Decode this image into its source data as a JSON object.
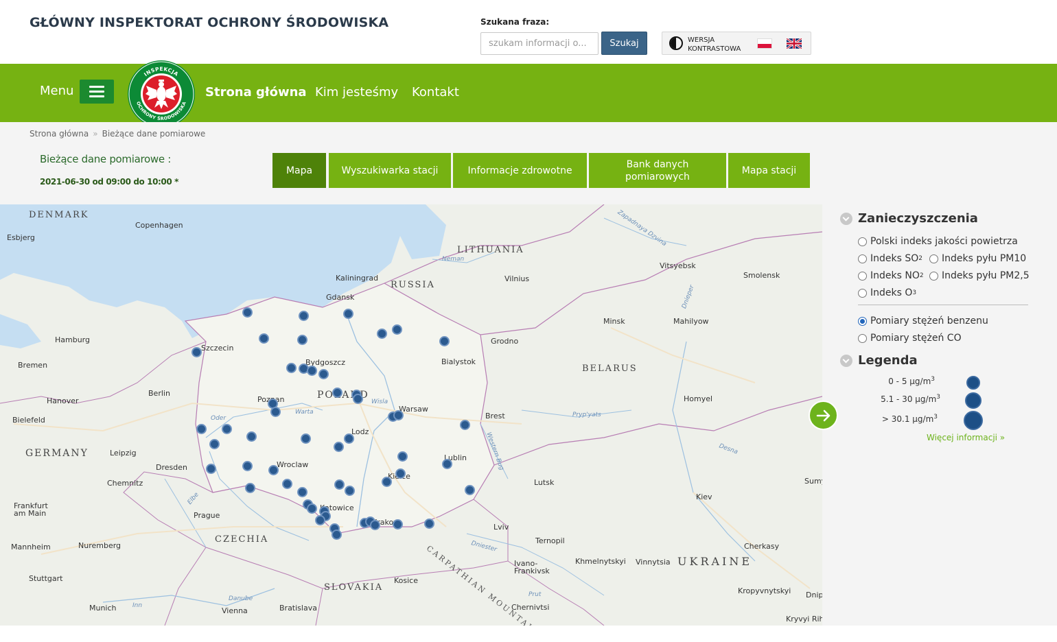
{
  "header": {
    "site_title": "GŁÓWNY INSPEKTORAT OCHRONY ŚRODOWISKA",
    "search_label": "Szukana fraza:",
    "search_placeholder": "szukam informacji o...",
    "search_button": "Szukaj",
    "contrast_line1": "WERSJA",
    "contrast_line2": "KONTRASTOWA"
  },
  "nav": {
    "menu_label": "Menu",
    "links": [
      "Strona główna",
      "Kim jesteśmy",
      "Kontakt"
    ]
  },
  "breadcrumb": [
    "Strona główna",
    "Bieżące dane pomiarowe"
  ],
  "current": {
    "title": "Bieżące dane pomiarowe :",
    "date": "2021-06-30 od 09:00 do 10:00 *"
  },
  "tabs": [
    {
      "line1": "Mapa",
      "line2": ""
    },
    {
      "line1": "Wyszukiwarka stacji",
      "line2": ""
    },
    {
      "line1": "Informacje zdrowotne",
      "line2": ""
    },
    {
      "line1": "Bank danych",
      "line2": "pomiarowych"
    },
    {
      "line1": "Mapa stacji",
      "line2": ""
    }
  ],
  "map": {
    "countries": [
      "DENMARK",
      "LITHUANIA",
      "RUSSIA",
      "BELARUS",
      "POLAND",
      "GERMANY",
      "CZECHIA",
      "SLOVAKIA",
      "UKRAINE"
    ],
    "cities": [
      "Copenhagen",
      "Esbjerg",
      "Kaliningrad",
      "Vilnius",
      "Gdansk",
      "Hamburg",
      "Szczecin",
      "Bremen",
      "Bydgoszcz",
      "Bialystok",
      "Grodno",
      "Minsk",
      "Vitsyebsk",
      "Smolensk",
      "Mahilyow",
      "Hanover",
      "Berlin",
      "Poznan",
      "Warsaw",
      "Bielefeld",
      "Brest",
      "Homyel",
      "Lodz",
      "Leipzig",
      "Dresden",
      "Wroclaw",
      "Lublin",
      "Chemnitz",
      "Kielce",
      "Lutsk",
      "Katowice",
      "Kiev",
      "Frankfurt am Main",
      "Prague",
      "Krakow",
      "Lviv",
      "Ternopil",
      "Mannheim",
      "Nuremberg",
      "Khmelnytskyi",
      "Vinnytsia",
      "Ivano-Frankivsk",
      "Kosice",
      "Cherkasy",
      "Stuttgart",
      "Munich",
      "Vienna",
      "Bratislava",
      "Chernivtsi",
      "Kropyvnytskyi",
      "Kryvyi Rih",
      "Sumy",
      "Dnip"
    ],
    "rivers": [
      "Neman",
      "Zapadnaya Dzvina",
      "Dnieper",
      "Wisla",
      "Warta",
      "Oder",
      "Pryp'yats",
      "Desna",
      "Elbe",
      "Danube",
      "Inn",
      "Prut",
      "Dniester",
      "Western Bug"
    ],
    "mountains": "CARPATHIAN MOUNTAINS"
  },
  "sidebar": {
    "pollutants_title": "Zanieczyszczenia",
    "options": [
      {
        "label": "Polski indeks jakości powietrza",
        "checked": false
      },
      {
        "label": "Indeks SO",
        "sub": "2",
        "checked": false
      },
      {
        "label": "Indeks pyłu PM10",
        "checked": false
      },
      {
        "label": "Indeks NO",
        "sub": "2",
        "checked": false
      },
      {
        "label": "Indeks pyłu PM2,5",
        "checked": false
      },
      {
        "label": "Indeks O",
        "sub": "3",
        "checked": false
      },
      {
        "label": "Pomiary stężeń benzenu",
        "checked": true
      },
      {
        "label": "Pomiary stężeń CO",
        "checked": false
      }
    ],
    "legend_title": "Legenda",
    "legend": [
      {
        "label": "0 - 5 µg/m",
        "sup": "3"
      },
      {
        "label": "5.1 - 30 µg/m",
        "sup": "3"
      },
      {
        "label": "> 30.1 µg/m",
        "sup": "3"
      }
    ],
    "more_link": "Więcej informacji »"
  },
  "colors": {
    "nav_green": "#76b212",
    "tab_active": "#4e8209",
    "station_blue": "#2b5a8f",
    "search_button": "#3b6488"
  }
}
